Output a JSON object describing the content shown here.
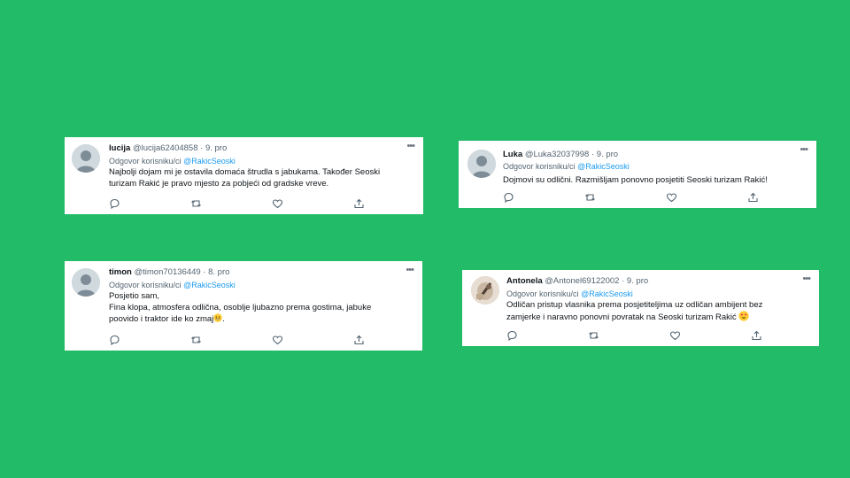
{
  "tweets": [
    {
      "name": "lucija",
      "handle": "@lucija62404858",
      "date": "· 9. pro",
      "reply_prefix": "Odgovor korisniku/ci",
      "reply_to": "@RakicSeoski",
      "lines": [
        "Najbolji dojam mi je ostavila domaća štrudla s jabukama. Također Seoski",
        "turizam Rakić je pravo mjesto za pobjeći od gradske vreve."
      ],
      "avatar_type": "default",
      "more_icon": "more-icon"
    },
    {
      "name": "Luka",
      "handle": "@Luka32037998",
      "date": "· 9. pro",
      "reply_prefix": "Odgovor korisniku/ci",
      "reply_to": "@RakicSeoski",
      "lines": [
        "Dojmovi su odlični. Razmišljam ponovno posjetiti Seoski turizam Rakić!"
      ],
      "avatar_type": "default",
      "more_icon": "more-icon"
    },
    {
      "name": "timon",
      "handle": "@timon70136449",
      "date": "· 8. pro",
      "reply_prefix": "Odgovor korisniku/ci",
      "reply_to": "@RakicSeoski",
      "lines": [
        "Posjetio sam,",
        "Fina klopa, atmosfera odlična, osoblje ljubazno prema gostima, jabuke",
        "poovido i traktor ide ko zmaj"
      ],
      "emoji": "grinning-face",
      "avatar_type": "default",
      "more_icon": "more-icon"
    },
    {
      "name": "Antonela",
      "handle": "@Antonel69122002",
      "date": "· 9. pro",
      "reply_prefix": "Odgovor korisniku/ci",
      "reply_to": "@RakicSeoski",
      "lines": [
        "Odličan pristup vlasnika prema posjetiteljima uz odličan ambijent bez",
        "zamjerke i naravno ponovni povratak na Seoski turizam Rakić"
      ],
      "emoji": "heart-eyes-face",
      "avatar_type": "photo",
      "more_icon": "more-icon"
    }
  ],
  "action_icons": [
    "reply-icon",
    "retweet-icon",
    "like-icon",
    "share-icon"
  ],
  "colors": {
    "background": "#22bb67",
    "card": "#ffffff",
    "mention": "#1d9bf0",
    "secondary_text": "#536471"
  }
}
